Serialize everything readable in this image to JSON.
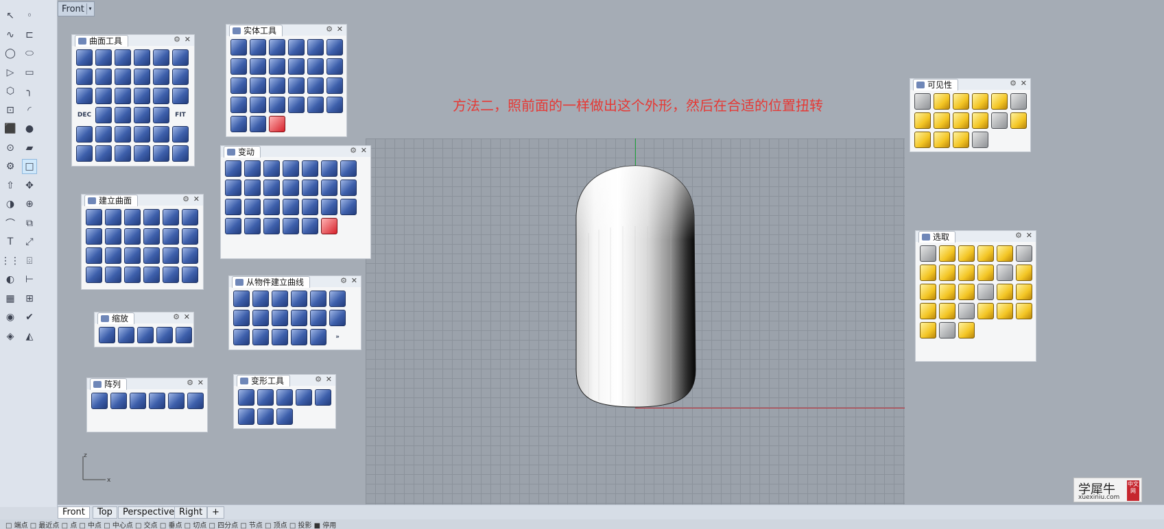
{
  "viewport": {
    "title": "Front",
    "dropdown_icon": "▾"
  },
  "annotation": "方法二，照前面的一样做出这个外形，然后在合适的位置扭转",
  "left_toolbar": {
    "icons": [
      "select-arrow-icon",
      "point-icon",
      "polyline-icon",
      "curve-icon",
      "circle-icon",
      "ellipse-icon",
      "polygon-icon",
      "rectangle-icon",
      "hexagon-icon",
      "fillet-icon",
      "control-points-icon",
      "arc-icon",
      "box-icon",
      "sphere-icon",
      "cylinder-icon",
      "plane-icon",
      "transform-gear-icon",
      "selected-square-icon",
      "extrude-icon",
      "move-icon",
      "boolean-icon",
      "group-icon",
      "blend-icon",
      "offset-icon",
      "text-icon",
      "scale-icon",
      "array-icon",
      "edit-icon",
      "analyze-icon",
      "dim-icon",
      "grid-icon",
      "cage-icon",
      "render-icon",
      "check-icon",
      "mesh-icon",
      "paint-icon"
    ]
  },
  "panels": {
    "surface_tools": {
      "title": "曲面工具"
    },
    "solid_tools": {
      "title": "实体工具"
    },
    "transform": {
      "title": "变动"
    },
    "create_surface": {
      "title": "建立曲面"
    },
    "from_object": {
      "title": "从物件建立曲线"
    },
    "zoom": {
      "title": "缩放"
    },
    "array": {
      "title": "阵列"
    },
    "deform": {
      "title": "变形工具"
    },
    "visibility": {
      "title": "可见性"
    },
    "select": {
      "title": "选取"
    }
  },
  "panel_text_icons": {
    "dec": "DEC",
    "fit": "FIT",
    "more": "»"
  },
  "viewport_tabs": [
    "Front",
    "Top",
    "Perspective",
    "Right"
  ],
  "add_tab": "+",
  "axis": {
    "z": "z",
    "x": "x"
  },
  "watermark": {
    "title": "学犀牛",
    "url": "xuexiniu.com",
    "badge": "中文网"
  },
  "status_bar": "□ 端点  □ 最近点  □ 点  □ 中点  □ 中心点  □ 交点  □ 垂点  □ 切点  □ 四分点  □ 节点  □ 顶点  □ 投影  ■ 停用",
  "colors": {
    "annotation": "#e53935",
    "axis_x": "#c0262f",
    "axis_y": "#1fa53a",
    "viewport_bg": "#a5acb5"
  }
}
